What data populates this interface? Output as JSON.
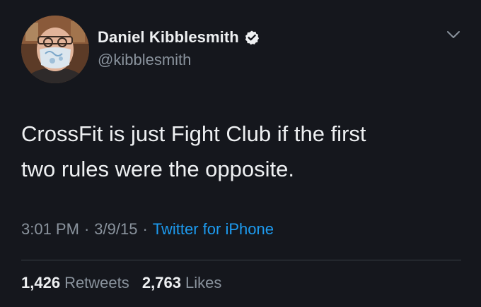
{
  "user": {
    "display_name": "Daniel Kibblesmith",
    "handle": "@kibblesmith",
    "verified": true,
    "avatar_icon": "avatar-photo"
  },
  "menu": {
    "icon": "chevron-down-icon"
  },
  "tweet": {
    "text_lines": [
      "CrossFit is just Fight Club if the first",
      "two rules were the opposite."
    ]
  },
  "meta": {
    "time": "3:01 PM",
    "date": "3/9/15",
    "separator": "·",
    "source": "Twitter for iPhone"
  },
  "stats": {
    "retweets_count": "1,426",
    "retweets_label": "Retweets",
    "likes_count": "2,763",
    "likes_label": "Likes"
  },
  "colors": {
    "background": "#15171d",
    "text": "#eef0f2",
    "secondary": "#8a939d",
    "link": "#1d9bf0"
  }
}
